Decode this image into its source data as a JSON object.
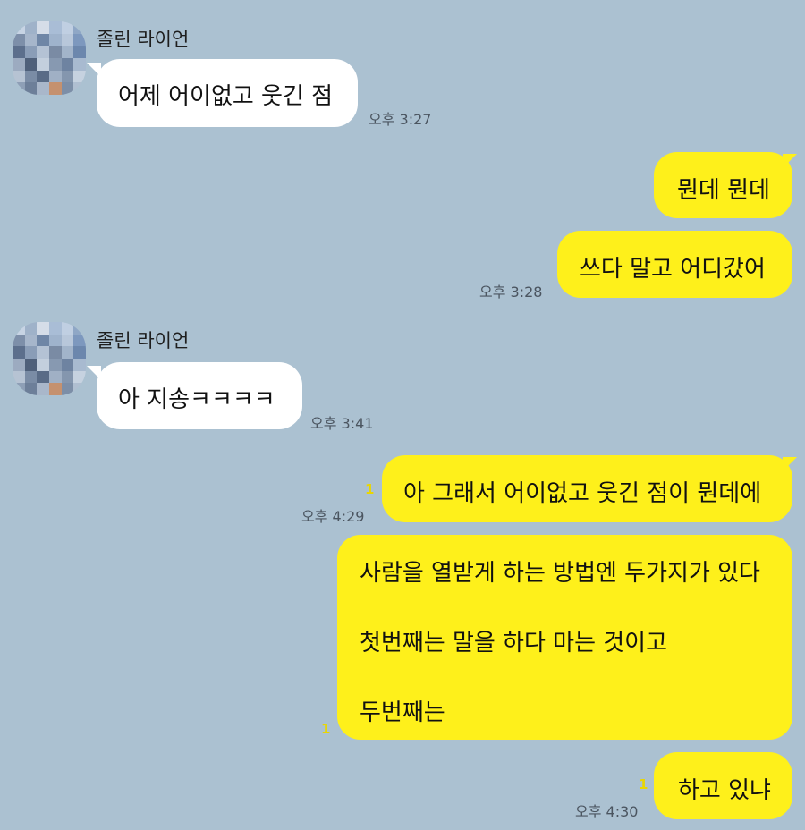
{
  "sender_name": "졸린 라이언",
  "messages": {
    "m1": {
      "text": "어제 어이없고 웃긴 점",
      "time": "오후 3:27"
    },
    "m2": {
      "text": "뭔데 뭔데"
    },
    "m3": {
      "text": "쓰다 말고 어디갔어",
      "time": "오후 3:28"
    },
    "m4": {
      "text": "아 지송ㅋㅋㅋㅋ",
      "time": "오후 3:41"
    },
    "m5": {
      "text": "아 그래서 어이없고 웃긴 점이 뭔데에",
      "time": "오후 4:29",
      "unread": "1"
    },
    "m6": {
      "line1": "사람을 열받게 하는 방법엔 두가지가 있다",
      "line2": "첫번째는 말을 하다 마는 것이고",
      "line3": "두번째는",
      "unread": "1"
    },
    "m7": {
      "text": "하고 있냐",
      "time": "오후 4:30",
      "unread": "1"
    }
  },
  "colors": {
    "background": "#abc1d1",
    "incoming_bubble": "#ffffff",
    "outgoing_bubble": "#fef01b",
    "unread_count": "#e9d600"
  }
}
